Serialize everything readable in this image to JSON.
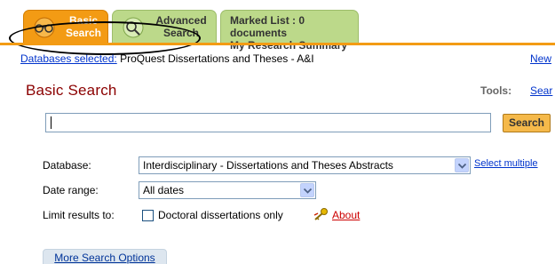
{
  "tabs": {
    "basic": {
      "line1": "Basic",
      "line2": "Search"
    },
    "advanced": {
      "line1": "Advanced",
      "line2": "Search"
    },
    "marked": {
      "line1": "Marked List : 0 documents",
      "line2": "My Research Summary"
    }
  },
  "db_selected": {
    "link": "Databases selected:",
    "name": "ProQuest Dissertations and Theses - A&I"
  },
  "new_link": "New",
  "heading": "Basic Search",
  "tools": {
    "label": "Tools:",
    "link": "Sear"
  },
  "search": {
    "value": "",
    "button": "Search"
  },
  "form": {
    "database_label": "Database:",
    "database_value": "Interdisciplinary - Dissertations and Theses Abstracts",
    "select_multiple": "Select multiple",
    "date_label": "Date range:",
    "date_value": "All dates",
    "limit_label": "Limit results to:",
    "limit_option": "Doctoral dissertations only",
    "about": "About"
  },
  "more_options": "More Search Options",
  "colors": {
    "active_tab": "#f39b14",
    "inactive_tab": "#bcd98a",
    "heading": "#8b0000",
    "link": "#0033cc"
  }
}
